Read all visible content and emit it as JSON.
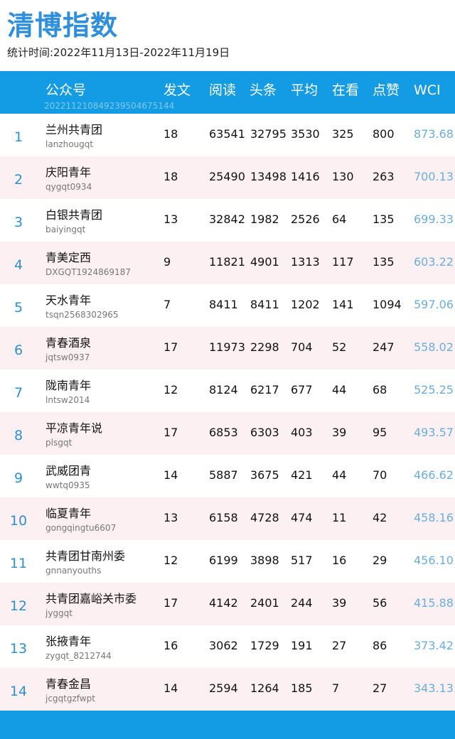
{
  "title": "清博指数",
  "period": "统计时间:2022年11月13日-2022年11月19日",
  "header": {
    "account": "公众号",
    "posts": "发文",
    "reads": "阅读",
    "headline": "头条",
    "average": "平均",
    "watching": "在看",
    "likes": "点赞",
    "wci": "WCI",
    "stamp": "20221121084923950467514​4"
  },
  "rows": [
    {
      "rank": "1",
      "name": "兰州共青团",
      "account": "lanzhougqt",
      "posts": "18",
      "reads": "63541",
      "headline": "32795",
      "average": "3530",
      "watching": "325",
      "likes": "800",
      "wci": "873.68"
    },
    {
      "rank": "2",
      "name": "庆阳青年",
      "account": "qygqt0934",
      "posts": "18",
      "reads": "25490",
      "headline": "13498",
      "average": "1416",
      "watching": "130",
      "likes": "263",
      "wci": "700.13"
    },
    {
      "rank": "3",
      "name": "白银共青团",
      "account": "baiyingqt",
      "posts": "13",
      "reads": "32842",
      "headline": "1982",
      "average": "2526",
      "watching": "64",
      "likes": "135",
      "wci": "699.33"
    },
    {
      "rank": "4",
      "name": "青美定西",
      "account": "DXGQT1924869187",
      "posts": "9",
      "reads": "11821",
      "headline": "4901",
      "average": "1313",
      "watching": "117",
      "likes": "135",
      "wci": "603.22"
    },
    {
      "rank": "5",
      "name": "天水青年",
      "account": "tsqn2568302965",
      "posts": "7",
      "reads": "8411",
      "headline": "8411",
      "average": "1202",
      "watching": "141",
      "likes": "1094",
      "wci": "597.06"
    },
    {
      "rank": "6",
      "name": "青春酒泉",
      "account": "jqtsw0937",
      "posts": "17",
      "reads": "11973",
      "headline": "2298",
      "average": "704",
      "watching": "52",
      "likes": "247",
      "wci": "558.02"
    },
    {
      "rank": "7",
      "name": "陇南青年",
      "account": "lntsw2014",
      "posts": "12",
      "reads": "8124",
      "headline": "6217",
      "average": "677",
      "watching": "44",
      "likes": "68",
      "wci": "525.25"
    },
    {
      "rank": "8",
      "name": "平凉青年说",
      "account": "plsgqt",
      "posts": "17",
      "reads": "6853",
      "headline": "6303",
      "average": "403",
      "watching": "39",
      "likes": "95",
      "wci": "493.57"
    },
    {
      "rank": "9",
      "name": "武威团青",
      "account": "wwtq0935",
      "posts": "14",
      "reads": "5887",
      "headline": "3675",
      "average": "421",
      "watching": "44",
      "likes": "70",
      "wci": "466.62"
    },
    {
      "rank": "10",
      "name": "临夏青年",
      "account": "gongqingtu6607",
      "posts": "13",
      "reads": "6158",
      "headline": "4728",
      "average": "474",
      "watching": "11",
      "likes": "42",
      "wci": "458.16"
    },
    {
      "rank": "11",
      "name": "共青团甘南州委",
      "account": "gnnanyouths",
      "posts": "12",
      "reads": "6199",
      "headline": "3898",
      "average": "517",
      "watching": "16",
      "likes": "29",
      "wci": "456.10"
    },
    {
      "rank": "12",
      "name": "共青团嘉峪关市委",
      "account": "jyggqt",
      "posts": "17",
      "reads": "4142",
      "headline": "2401",
      "average": "244",
      "watching": "39",
      "likes": "56",
      "wci": "415.88"
    },
    {
      "rank": "13",
      "name": "张掖青年",
      "account": "zygqt_8212744",
      "posts": "16",
      "reads": "3062",
      "headline": "1729",
      "average": "191",
      "watching": "27",
      "likes": "86",
      "wci": "373.42"
    },
    {
      "rank": "14",
      "name": "青春金昌",
      "account": "jcgqtgzfwpt",
      "posts": "14",
      "reads": "2594",
      "headline": "1264",
      "average": "185",
      "watching": "7",
      "likes": "27",
      "wci": "343.13"
    }
  ]
}
